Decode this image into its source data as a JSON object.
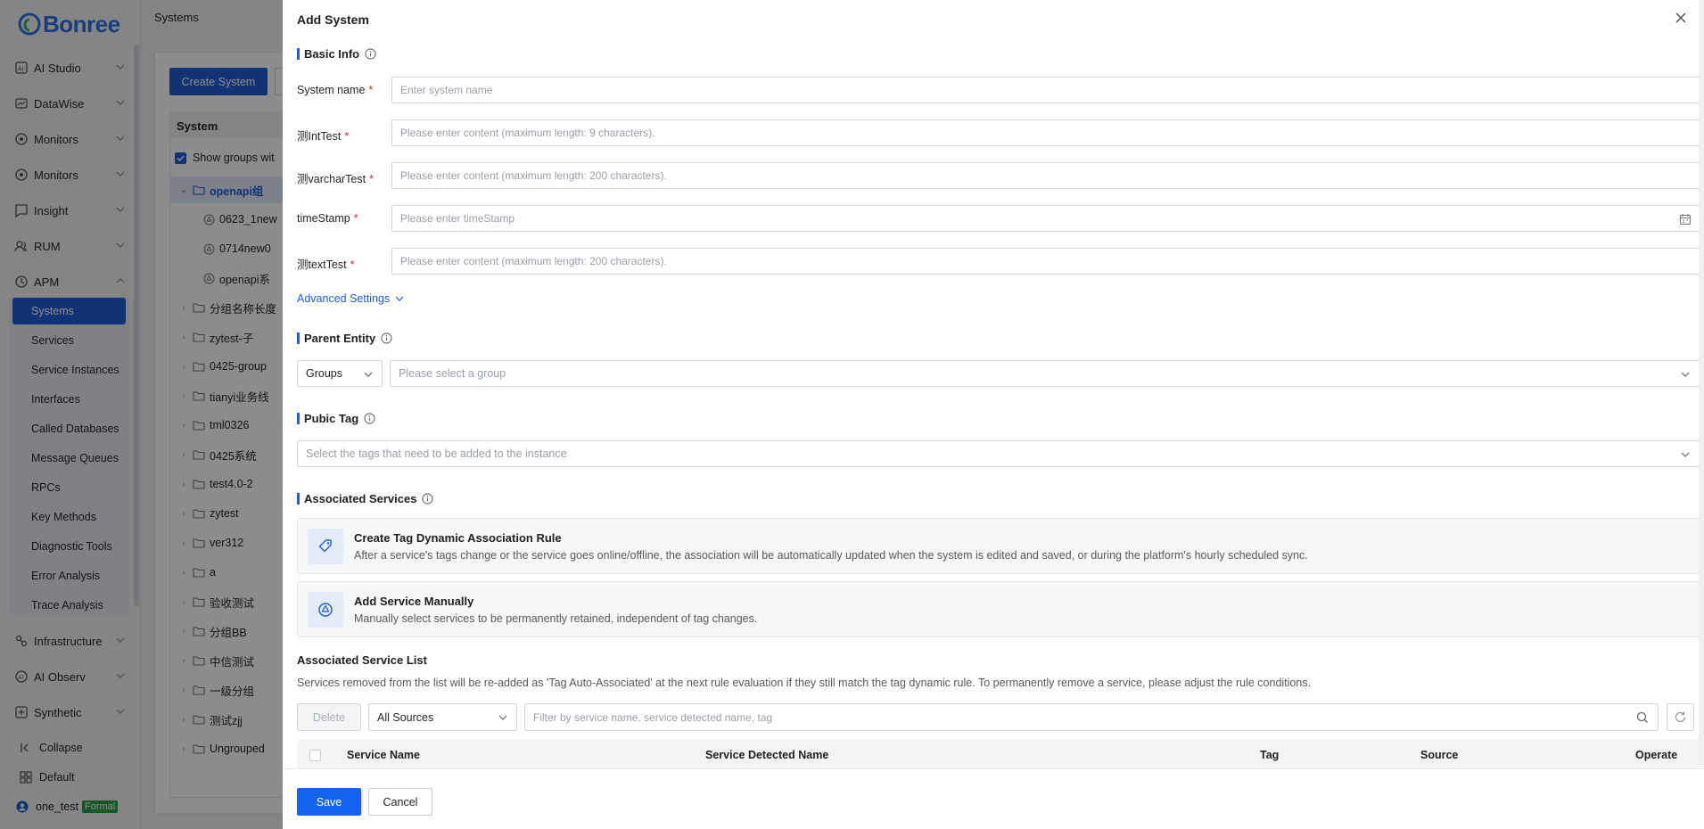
{
  "sidebar": {
    "brand": "Bonree",
    "sections": [
      {
        "label": "AI Studio",
        "icon": "ai-studio-icon"
      },
      {
        "label": "DataWise",
        "icon": "datawise-icon"
      },
      {
        "label": "Monitors",
        "icon": "monitors-icon"
      },
      {
        "label": "Monitors",
        "icon": "monitors-icon"
      },
      {
        "label": "Insight",
        "icon": "insight-icon"
      },
      {
        "label": "RUM",
        "icon": "rum-icon"
      },
      {
        "label": "APM",
        "icon": "apm-icon"
      }
    ],
    "apm_items": [
      "Systems",
      "Services",
      "Service Instances",
      "Interfaces",
      "Called Databases",
      "Message Queues",
      "RPCs",
      "Key Methods",
      "Diagnostic Tools",
      "Error Analysis",
      "Trace Analysis"
    ],
    "active_item": "Systems",
    "lower_sections": [
      {
        "label": "Infrastructure",
        "icon": "infrastructure-icon"
      },
      {
        "label": "AI Observ",
        "icon": "ai-observ-icon"
      },
      {
        "label": "Synthetic",
        "icon": "synthetic-icon"
      }
    ],
    "collapse_label": "Collapse",
    "workspace_label": "Default",
    "user_name": "one_test",
    "user_badge": "Formal"
  },
  "page": {
    "title": "Systems",
    "create_button": "Create System",
    "tree_header": "System",
    "show_groups": "Show groups wit",
    "tree": [
      {
        "label": "openapi组",
        "type": "group",
        "expanded": true,
        "selected": true
      },
      {
        "label": "0623_1new",
        "type": "service"
      },
      {
        "label": "0714new0",
        "type": "service"
      },
      {
        "label": "openapi系",
        "type": "service"
      },
      {
        "label": "分组名称长度",
        "type": "group"
      },
      {
        "label": "zytest-子",
        "type": "group"
      },
      {
        "label": "0425-group",
        "type": "group"
      },
      {
        "label": "tianyi业务线",
        "type": "group"
      },
      {
        "label": "tml0326",
        "type": "group"
      },
      {
        "label": "0425系统",
        "type": "group"
      },
      {
        "label": "test4.0-2",
        "type": "group"
      },
      {
        "label": "zytest",
        "type": "group"
      },
      {
        "label": "ver312",
        "type": "group"
      },
      {
        "label": "a",
        "type": "group"
      },
      {
        "label": "验收测试",
        "type": "group"
      },
      {
        "label": "分组BB",
        "type": "group"
      },
      {
        "label": "中信测试",
        "type": "group"
      },
      {
        "label": "一级分组",
        "type": "group"
      },
      {
        "label": "测试zjj",
        "type": "group"
      },
      {
        "label": "Ungrouped",
        "type": "group"
      }
    ]
  },
  "drawer": {
    "title": "Add System",
    "basic_info": "Basic Info",
    "fields": [
      {
        "label": "System name",
        "placeholder": "Enter system name"
      },
      {
        "label": "测IntTest",
        "placeholder": "Please enter content (maximum length: 9 characters)."
      },
      {
        "label": "测varcharTest",
        "placeholder": "Please enter content (maximum length: 200 characters)."
      },
      {
        "label": "timeStamp",
        "placeholder": "Please enter timeStamp"
      },
      {
        "label": "测textTest",
        "placeholder": "Please enter content (maximum length: 200 characters)."
      }
    ],
    "advanced_settings": "Advanced Settings",
    "parent_entity": "Parent Entity",
    "parent_type": "Groups",
    "group_placeholder": "Please select a group",
    "public_tag": "Pubic Tag",
    "tag_placeholder": "Select the tags that need to be added to the instance",
    "associated_services": "Associated Services",
    "cards": [
      {
        "title": "Create Tag Dynamic Association Rule",
        "desc": "After a service's tags change or the service goes online/offline, the association will be automatically updated when the system is edited and saved, or during the platform's hourly scheduled sync."
      },
      {
        "title": "Add Service Manually",
        "desc": "Manually select services to be permanently retained, independent of tag changes."
      }
    ],
    "list_title": "Associated Service List",
    "list_desc": "Services removed from the list will be re-added as 'Tag Auto-Associated' at the next rule evaluation if they still match the tag dynamic rule. To permanently remove a service, please adjust the rule conditions.",
    "delete_button": "Delete",
    "source_filter": "All Sources",
    "filter_placeholder": "Filter by service name, service detected name, tag",
    "columns": [
      "Service Name",
      "Service Detected Name",
      "Tag",
      "Source",
      "Operate"
    ],
    "save_button": "Save",
    "cancel_button": "Cancel"
  },
  "colors": {
    "accent": "#1f5dd6",
    "primary_button": "#1464f0",
    "required": "#e02424",
    "badge": "#2e9d4c"
  }
}
